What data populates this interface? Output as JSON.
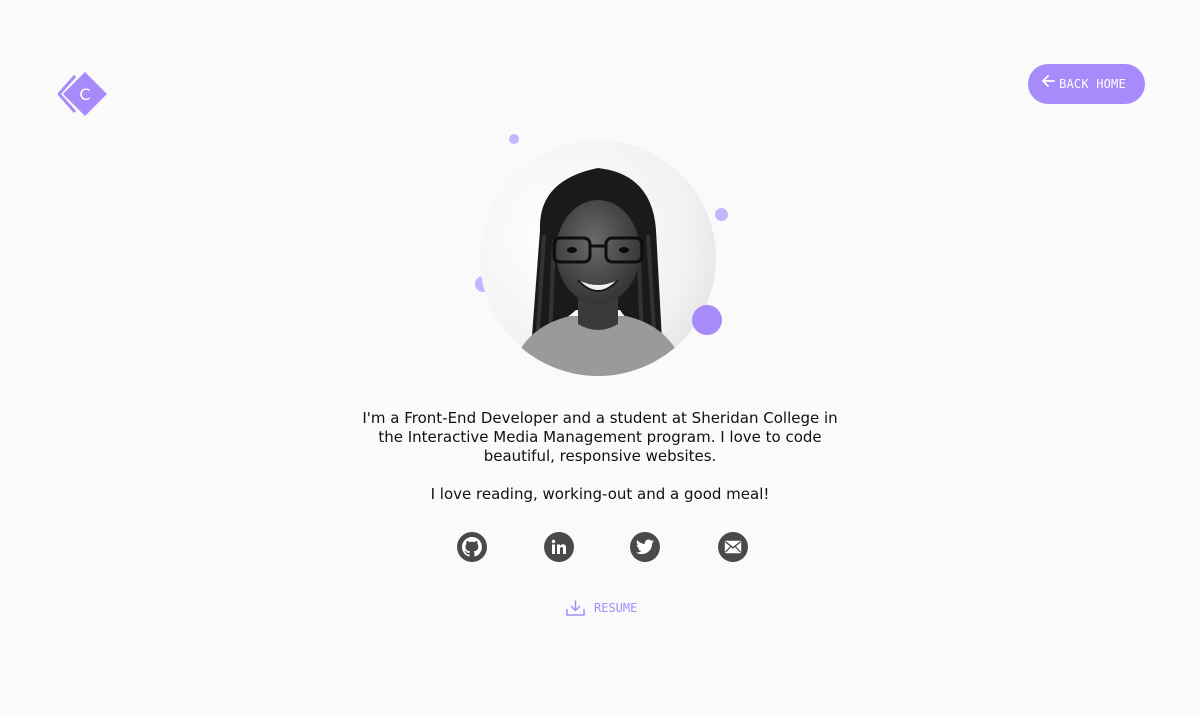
{
  "header": {
    "logo_letter": "C",
    "back_home_label": "BACK HOME"
  },
  "bio": {
    "paragraph1": "I'm a Front-End Developer and a student at Sheridan College in the Interactive Media Management program. I love to code beautiful, responsive websites.",
    "paragraph2": "I love reading, working-out and a good meal!"
  },
  "social": [
    {
      "name": "github",
      "icon": "github-icon"
    },
    {
      "name": "linkedin",
      "icon": "linkedin-icon"
    },
    {
      "name": "twitter",
      "icon": "twitter-icon"
    },
    {
      "name": "email",
      "icon": "email-icon"
    }
  ],
  "resume": {
    "label": "RESUME"
  },
  "colors": {
    "accent": "#a78bfa",
    "accent_light": "#c4b5fd",
    "icon_dark": "#4a4a4a",
    "background": "#fafafa"
  }
}
